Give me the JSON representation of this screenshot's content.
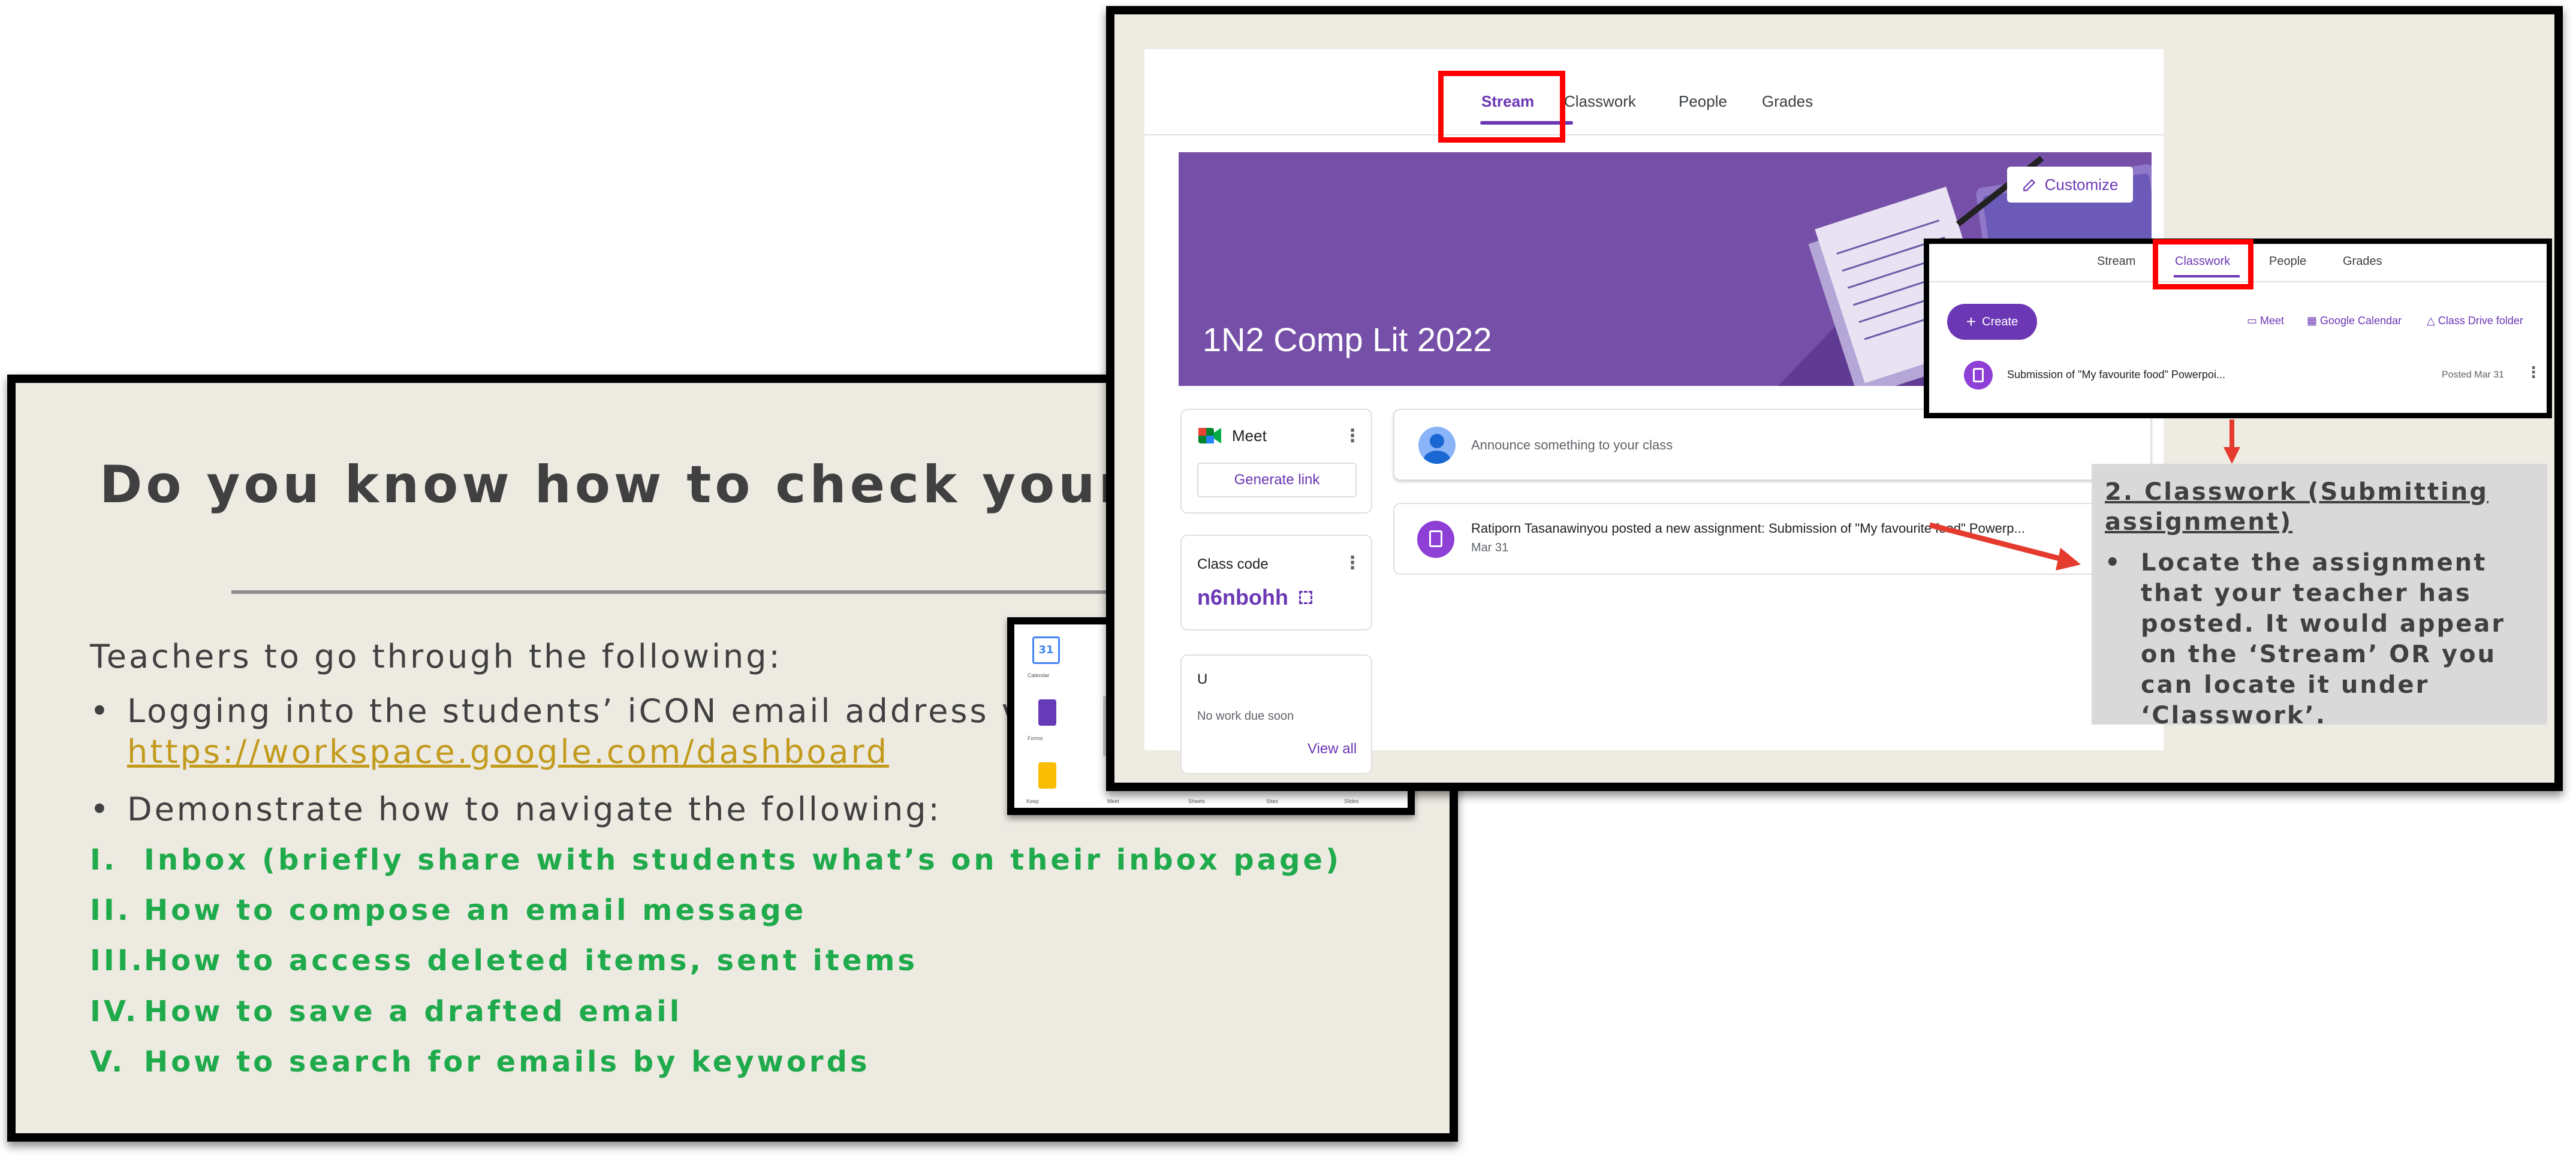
{
  "slide": {
    "title": "Do you know how to check your ema",
    "intro": "Teachers to go through the following:",
    "bullet1": "Logging into the students’ iCON email address via",
    "bullet1_link": "https://workspace.google.com/dashboard",
    "bullet2": "Demonstrate how to navigate the following:",
    "bullet_char": "•",
    "steps": [
      {
        "num": "I.",
        "text": "Inbox (briefly share with students what’s on their inbox page)"
      },
      {
        "num": "II.",
        "text": "How to compose an email message"
      },
      {
        "num": "III.",
        "text": "How to access deleted items, sent items"
      },
      {
        "num": "IV.",
        "text": "How to save a drafted email"
      },
      {
        "num": "V.",
        "text": "How to search for emails by keywords"
      }
    ]
  },
  "apps_thumb": {
    "labels": [
      "Calendar",
      "Forms",
      "Keep",
      "Meet",
      "Sheets",
      "Sites",
      "Slides"
    ],
    "calendar_day": "31",
    "colors": {
      "calendar": "#4285f4",
      "forms": "#673ab7",
      "keep": "#fbbc04"
    }
  },
  "classroom": {
    "tabs": [
      "Stream",
      "Classwork",
      "People",
      "Grades"
    ],
    "class_name": "1N2 Comp Lit 2022",
    "customize_label": "Customize",
    "meet_label": "Meet",
    "generate_link": "Generate link",
    "class_code_label": "Class code",
    "class_code": "n6nbohh",
    "upcoming_label": "U",
    "no_work": "No work due soon",
    "view_all": "View all",
    "announce_placeholder": "Announce something to your class",
    "post_text": "Ratiporn Tasanawinyou posted a new assignment: Submission of \"My favourite food\" Powerp...",
    "post_date": "Mar 31",
    "accent": "#6b37b4",
    "banner_color": "#7650a8"
  },
  "classwork_inset": {
    "tabs": [
      "Stream",
      "Classwork",
      "People",
      "Grades"
    ],
    "create_label": "Create",
    "meet_label": "Meet",
    "calendar_label": "Google Calendar",
    "drive_label": "Class Drive folder",
    "item_text": "Submission of \"My favourite food\" Powerpoi...",
    "item_date": "Posted Mar 31"
  },
  "note": {
    "title": "2. Classwork (Submitting assignment)",
    "body": "Locate the assignment that your teacher has posted. It would appear on the ‘Stream’ OR you can locate it under ‘Classwork’.",
    "bullet_char": "•"
  }
}
